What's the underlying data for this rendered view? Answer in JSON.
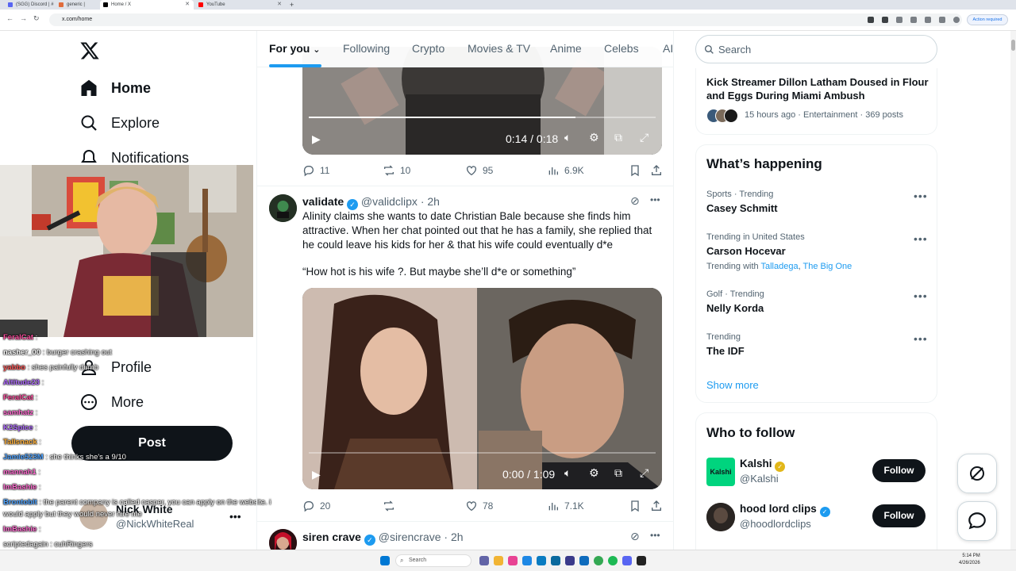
{
  "browser": {
    "tabs": [
      {
        "title": "(SGG) Discord | #",
        "color": "#5865f2"
      },
      {
        "title": "generic |",
        "color": "#e06c3c"
      },
      {
        "title": "Home / X",
        "color": "#000000"
      },
      {
        "title": "YouTube",
        "color": "#ff0000"
      }
    ],
    "url": "x.com/home",
    "action_required": "Action required"
  },
  "nav": {
    "home": "Home",
    "explore": "Explore",
    "notifications": "Notifications",
    "profile": "Profile",
    "more": "More",
    "post": "Post",
    "account_name": "Nick White",
    "account_handle": "@NickWhiteReal"
  },
  "chat": [
    {
      "name": "FeralCat",
      "color": "#ff4fa0",
      "msg": ":"
    },
    {
      "name": "nasher_00",
      "color": "#ffffff",
      "msg": ": burger crashing out"
    },
    {
      "name": "yabbo",
      "color": "#ff5a5a",
      "msg": ": shes painfully dumb"
    },
    {
      "name": "Altitude23",
      "color": "#b06bff",
      "msg": ":"
    },
    {
      "name": "FeralCat",
      "color": "#ff4fa0",
      "msg": ":"
    },
    {
      "name": "samhatz",
      "color": "#ff6bd0",
      "msg": ":"
    },
    {
      "name": "K2Spice",
      "color": "#b06bff",
      "msg": ":"
    },
    {
      "name": "Tallsnack",
      "color": "#ffb13b",
      "msg": ":"
    },
    {
      "name": "Jamie523M",
      "color": "#4fa3ff",
      "msg": ": she thinks she's a 9/10"
    },
    {
      "name": "mannah1",
      "color": "#ff6bd0",
      "msg": ":"
    },
    {
      "name": "ImBashie",
      "color": "#ff6bd0",
      "msg": ":"
    },
    {
      "name": "Brontoblt",
      "color": "#4fa3ff",
      "msg": ": the parent company is called casper, you can apply on the website. i"
    },
    {
      "name": "",
      "color": "#ffffff",
      "msg": "would apply but they would never hire me"
    },
    {
      "name": "ImBashie",
      "color": "#ff6bd0",
      "msg": ":"
    },
    {
      "name": "",
      "color": "#ffffff",
      "msg": "scriptedagain : cuhRingers"
    },
    {
      "name": "NonnerWatcher",
      "color": "#6bff6b",
      "msg": ":"
    }
  ],
  "feed_tabs": [
    "For you",
    "Following",
    "Crypto",
    "Movies & TV",
    "Anime",
    "Celebs",
    "AI"
  ],
  "tweet1": {
    "time": "0:14 / 0:18",
    "progress": 0.77,
    "replies": "11",
    "reposts": "10",
    "likes": "95",
    "views": "6.9K"
  },
  "tweet2": {
    "name": "validate",
    "handle": "@validclipx",
    "age": "2h",
    "text1": "Alinity claims she wants to date Christian Bale because she finds him attractive. When her chat pointed out that he has a family, she replied that he could leave his kids for her & that his wife could eventually d*e",
    "text2": "“How hot is his wife ?. But maybe she’ll d*e or something”",
    "time": "0:00 / 1:09",
    "replies": "20",
    "likes": "78",
    "views": "7.1K"
  },
  "tweet3": {
    "name": "siren crave",
    "handle": "@sirencrave",
    "age": "2h"
  },
  "search_placeholder": "Search",
  "news": {
    "title": "Kick Streamer Dillon Latham Doused in Flour and Eggs During Miami Ambush",
    "meta": "15 hours ago · Entertainment · 369 posts"
  },
  "happening": {
    "heading": "What’s happening",
    "trends": [
      {
        "meta": "Sports · Trending",
        "name": "Casey Schmitt"
      },
      {
        "meta": "Trending in United States",
        "name": "Carson Hocevar",
        "with": "Trending with",
        "links": [
          "Talladega",
          "The Big One"
        ]
      },
      {
        "meta": "Golf · Trending",
        "name": "Nelly Korda"
      },
      {
        "meta": "Trending",
        "name": "The IDF"
      }
    ],
    "show_more": "Show more"
  },
  "who_to_follow": {
    "heading": "Who to follow",
    "accounts": [
      {
        "name": "Kalshi",
        "handle": "@Kalshi",
        "logo": "Kalshi",
        "button": "Follow"
      },
      {
        "name": "hood lord clips",
        "handle": "@hoodlordclips",
        "button": "Follow"
      }
    ]
  },
  "taskbar": {
    "search": "Search",
    "time": "5:14 PM",
    "date": "4/26/2026"
  }
}
